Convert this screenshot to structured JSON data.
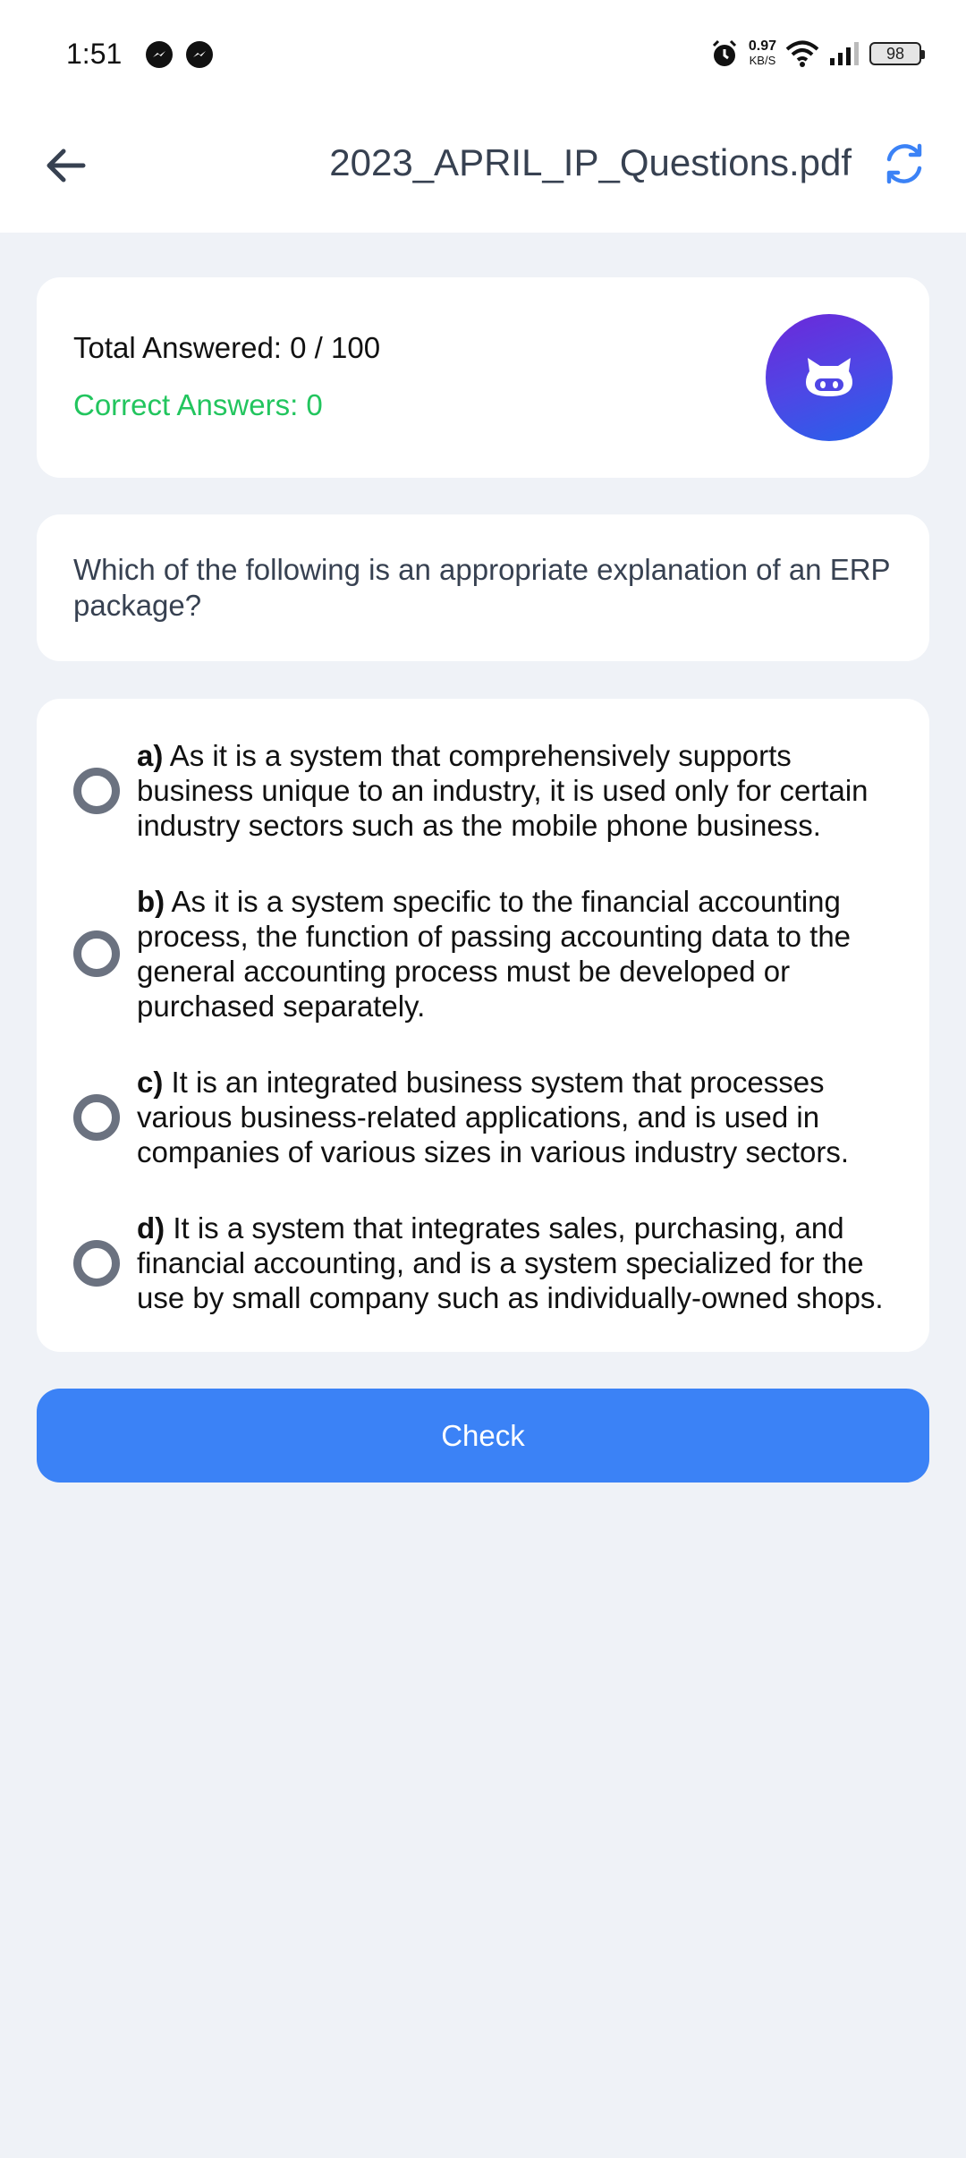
{
  "status_bar": {
    "time": "1:51",
    "net_speed_value": "0.97",
    "net_speed_unit": "KB/S",
    "battery": "98",
    "icons": [
      "messenger-icon",
      "messenger-icon",
      "alarm-icon",
      "wifi-icon",
      "signal-icon",
      "battery-icon"
    ]
  },
  "header": {
    "title": "2023_APRIL_IP_Questions.pdf",
    "back_icon": "arrow-left-icon",
    "refresh_icon": "refresh-icon",
    "accent_color": "#3b82f6"
  },
  "score": {
    "total_answered": "Total Answered: 0 / 100",
    "correct_answers": "Correct Answers: 0",
    "avatar_icon": "bot-icon"
  },
  "question": {
    "text": "Which of the following is an appropriate explanation of an ERP package?"
  },
  "options": [
    {
      "letter": "a)",
      "text": " As it is a system that comprehensively supports business unique to an industry, it is used only for certain industry sectors such as the mobile phone business."
    },
    {
      "letter": "b)",
      "text": " As it is a system specific to the financial accounting process, the function of passing accounting data to the general accounting process must be developed or purchased separately."
    },
    {
      "letter": "c)",
      "text": " It is an integrated business system that processes various business-related applications, and is used in companies of various sizes in various industry sectors."
    },
    {
      "letter": "d)",
      "text": " It is a system that integrates sales, purchasing, and financial accounting, and is a system specialized for the use by small company such as individually-owned shops."
    }
  ],
  "check_button": {
    "label": "Check"
  }
}
